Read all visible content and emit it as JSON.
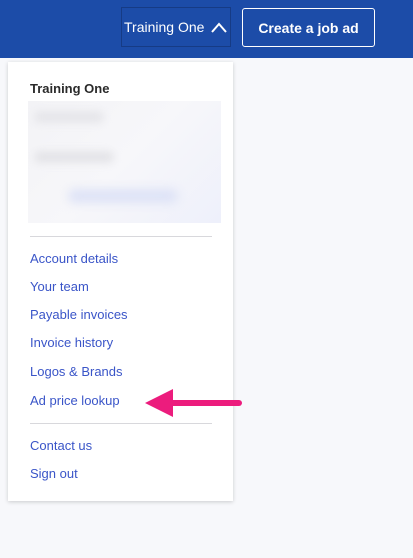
{
  "header": {
    "account_name": "Training One",
    "create_job_label": "Create a job ad"
  },
  "menu": {
    "account_name": "Training One",
    "primary_links": [
      {
        "label": "Account details"
      },
      {
        "label": "Your team"
      },
      {
        "label": "Payable invoices"
      },
      {
        "label": "Invoice history"
      },
      {
        "label": "Logos & Brands"
      },
      {
        "label": "Ad price lookup"
      }
    ],
    "secondary_links": [
      {
        "label": "Contact us"
      },
      {
        "label": "Sign out"
      }
    ]
  },
  "colors": {
    "header_bg": "#1c4ca8",
    "link": "#3a55c8",
    "annotation_arrow": "#ec1c7d"
  },
  "icons": {
    "account_toggle": "chevron-up-icon",
    "annotation": "arrow-left-icon"
  }
}
